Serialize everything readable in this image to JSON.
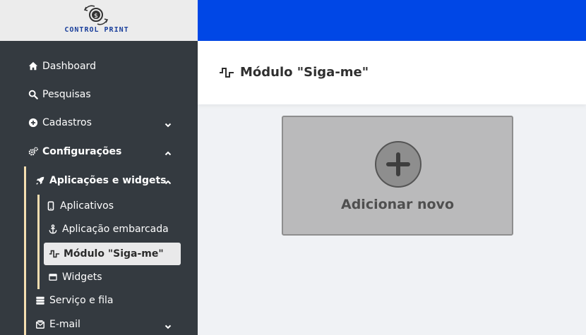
{
  "brand": {
    "name": "CONTROL PRINT"
  },
  "page": {
    "title": "Módulo \"Siga-me\""
  },
  "sidebar": {
    "dashboard": "Dashboard",
    "pesquisas": "Pesquisas",
    "cadastros": "Cadastros",
    "configuracoes": "Configurações",
    "aplicacoes_widgets": "Aplicações e widgets",
    "aplicativos": "Aplicativos",
    "aplicacao_embarcada": "Aplicação embarcada",
    "modulo_siga_me": "Módulo \"Siga-me\"",
    "widgets": "Widgets",
    "servico_fila": "Serviço e fila",
    "email": "E-mail"
  },
  "main": {
    "add_new_label": "Adicionar novo"
  },
  "colors": {
    "topbar": "#0047e6",
    "sidebar": "#343a40",
    "guide": "#f5deb0",
    "brand_text": "#1a3f9b"
  },
  "icons": {
    "dashboard": "home-icon",
    "pesquisas": "search-icon",
    "cadastros": "plus-circle-icon",
    "configuracoes": "cogs-icon",
    "aplicacoes": "rocket-icon",
    "aplicativos": "mobile-icon",
    "embarcada": "anchor-icon",
    "siga_me": "wave-square-icon",
    "widgets": "window-icon",
    "servico": "server-icon",
    "email": "mail-bulk-icon"
  }
}
